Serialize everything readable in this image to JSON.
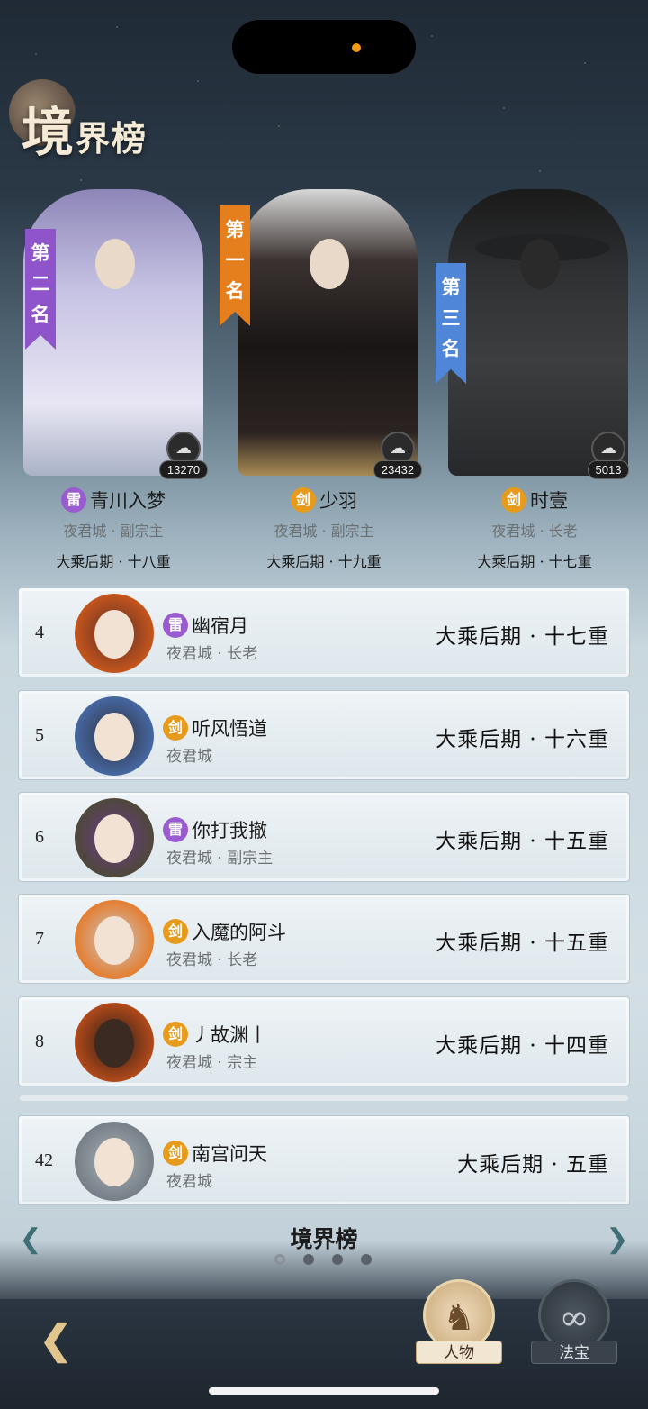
{
  "header": {
    "title_big": "境",
    "title_rest": "界榜"
  },
  "top3": [
    {
      "rank_label": "第二名",
      "score": "13270",
      "element": "雷",
      "element_color": "#9a5bd1",
      "name": "青川入梦",
      "sect": "夜君城 · 副宗主",
      "realm": "大乘后期 · 十八重"
    },
    {
      "rank_label": "第一名",
      "score": "23432",
      "element": "剑",
      "element_color": "#e79b1d",
      "name": "少羽",
      "sect": "夜君城 · 副宗主",
      "realm": "大乘后期 · 十九重"
    },
    {
      "rank_label": "第三名",
      "score": "5013",
      "element": "剑",
      "element_color": "#e79b1d",
      "name": "时壹",
      "sect": "夜君城 · 长老",
      "realm": "大乘后期 · 十七重"
    }
  ],
  "list": [
    {
      "rank": "4",
      "element": "雷",
      "name": "幽宿月",
      "sect": "夜君城 · 长老",
      "realm": "大乘后期 · 十七重"
    },
    {
      "rank": "5",
      "element": "剑",
      "name": "听风悟道",
      "sect": "夜君城",
      "realm": "大乘后期 · 十六重"
    },
    {
      "rank": "6",
      "element": "雷",
      "name": "你打我撤",
      "sect": "夜君城 · 副宗主",
      "realm": "大乘后期 · 十五重"
    },
    {
      "rank": "7",
      "element": "剑",
      "name": "入魔的阿斗",
      "sect": "夜君城 · 长老",
      "realm": "大乘后期 · 十五重"
    },
    {
      "rank": "8",
      "element": "剑",
      "name": "丿故渊丨",
      "sect": "夜君城 · 宗主",
      "realm": "大乘后期 · 十四重"
    }
  ],
  "self": {
    "rank": "42",
    "element": "剑",
    "name": "南宫问天",
    "sect": "夜君城",
    "realm": "大乘后期 · 五重"
  },
  "footer": {
    "board_title": "境界榜",
    "page_count": 4,
    "active_page": 1,
    "back_icon": "back-arrow-icon",
    "tabs": [
      {
        "label": "人物",
        "icon": "person-icon",
        "active": true
      },
      {
        "label": "法宝",
        "icon": "gourd-icon",
        "active": false
      }
    ]
  },
  "colors": {
    "lei": "#9a5bd1",
    "jian": "#e79b1d",
    "rank1": "#e57f1e",
    "rank2": "#8f54c9",
    "rank3": "#4f86d8"
  }
}
